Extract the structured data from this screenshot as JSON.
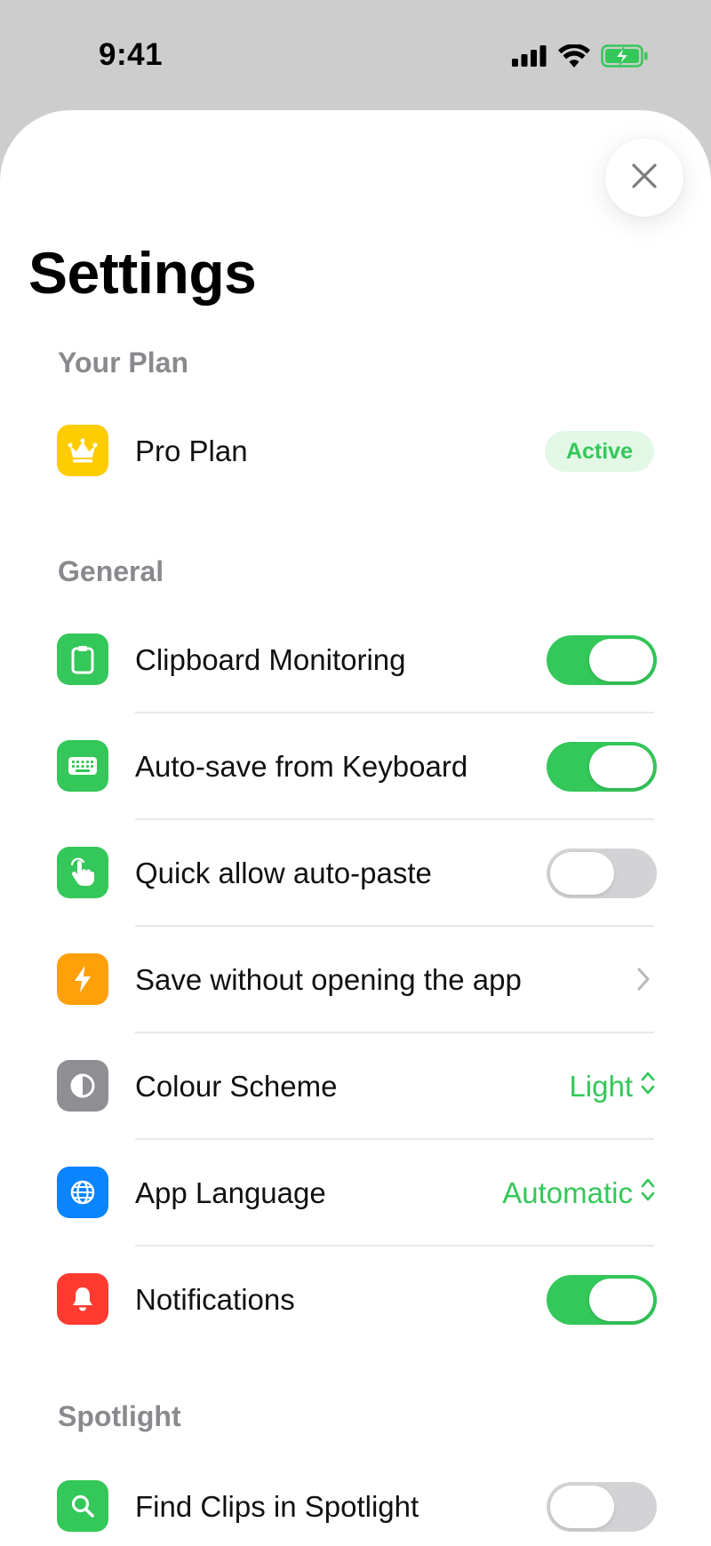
{
  "status_bar": {
    "time": "9:41"
  },
  "header": {
    "title": "Settings"
  },
  "colors": {
    "accent_green": "#34c759",
    "plan_icon": "#ffcc00",
    "orange_icon": "#ff9f0a",
    "gray_icon": "#8e8e93",
    "blue_icon": "#0a84ff",
    "red_icon": "#ff3b30"
  },
  "sections": {
    "plan": {
      "title": "Your Plan",
      "pro_plan": {
        "label": "Pro Plan",
        "badge": "Active",
        "icon": "crown-icon"
      }
    },
    "general": {
      "title": "General",
      "clipboard_monitoring": {
        "label": "Clipboard Monitoring",
        "icon": "clipboard-icon",
        "enabled": true
      },
      "auto_save_keyboard": {
        "label": "Auto-save from Keyboard",
        "icon": "keyboard-icon",
        "enabled": true
      },
      "quick_allow_autopaste": {
        "label": "Quick allow auto-paste",
        "icon": "hand-tap-icon",
        "enabled": false
      },
      "save_without_opening": {
        "label": "Save without opening the app",
        "icon": "bolt-icon"
      },
      "colour_scheme": {
        "label": "Colour Scheme",
        "icon": "contrast-icon",
        "value": "Light"
      },
      "app_language": {
        "label": "App Language",
        "icon": "globe-icon",
        "value": "Automatic"
      },
      "notifications": {
        "label": "Notifications",
        "icon": "bell-icon",
        "enabled": true
      }
    },
    "spotlight": {
      "title": "Spotlight",
      "find_clips": {
        "label": "Find Clips in Spotlight",
        "icon": "search-icon",
        "enabled": false
      }
    }
  }
}
